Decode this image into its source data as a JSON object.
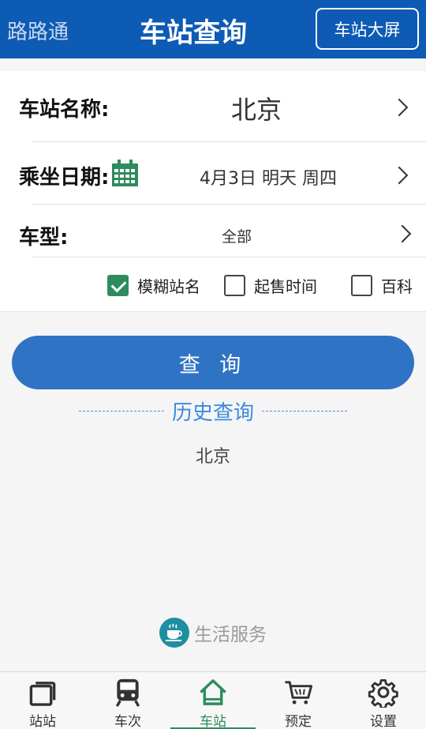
{
  "header": {
    "app_name": "路路通",
    "title": "车站查询",
    "screen_button": "车站大屏"
  },
  "form": {
    "station_label": "车站名称:",
    "station_value": "北京",
    "date_label": "乘坐日期:",
    "date_value": "4月3日 明天 周四",
    "type_label": "车型:",
    "type_value": "全部"
  },
  "checks": [
    {
      "label": "模糊站名",
      "checked": true
    },
    {
      "label": "起售时间",
      "checked": false
    },
    {
      "label": "百科",
      "checked": false
    }
  ],
  "query_button": "查 询",
  "history": {
    "title": "历史查询",
    "items": [
      "北京"
    ]
  },
  "life_service": "生活服务",
  "tabs": [
    {
      "label": "站站",
      "icon": "station-to-station-icon",
      "active": false
    },
    {
      "label": "车次",
      "icon": "train-icon",
      "active": false
    },
    {
      "label": "车站",
      "icon": "home-icon",
      "active": true
    },
    {
      "label": "预定",
      "icon": "cart-icon",
      "active": false
    },
    {
      "label": "设置",
      "icon": "gear-icon",
      "active": false
    }
  ],
  "colors": {
    "header": "#0d5bb5",
    "accent_green": "#2e8b5e",
    "button_blue": "#2f73c5"
  }
}
